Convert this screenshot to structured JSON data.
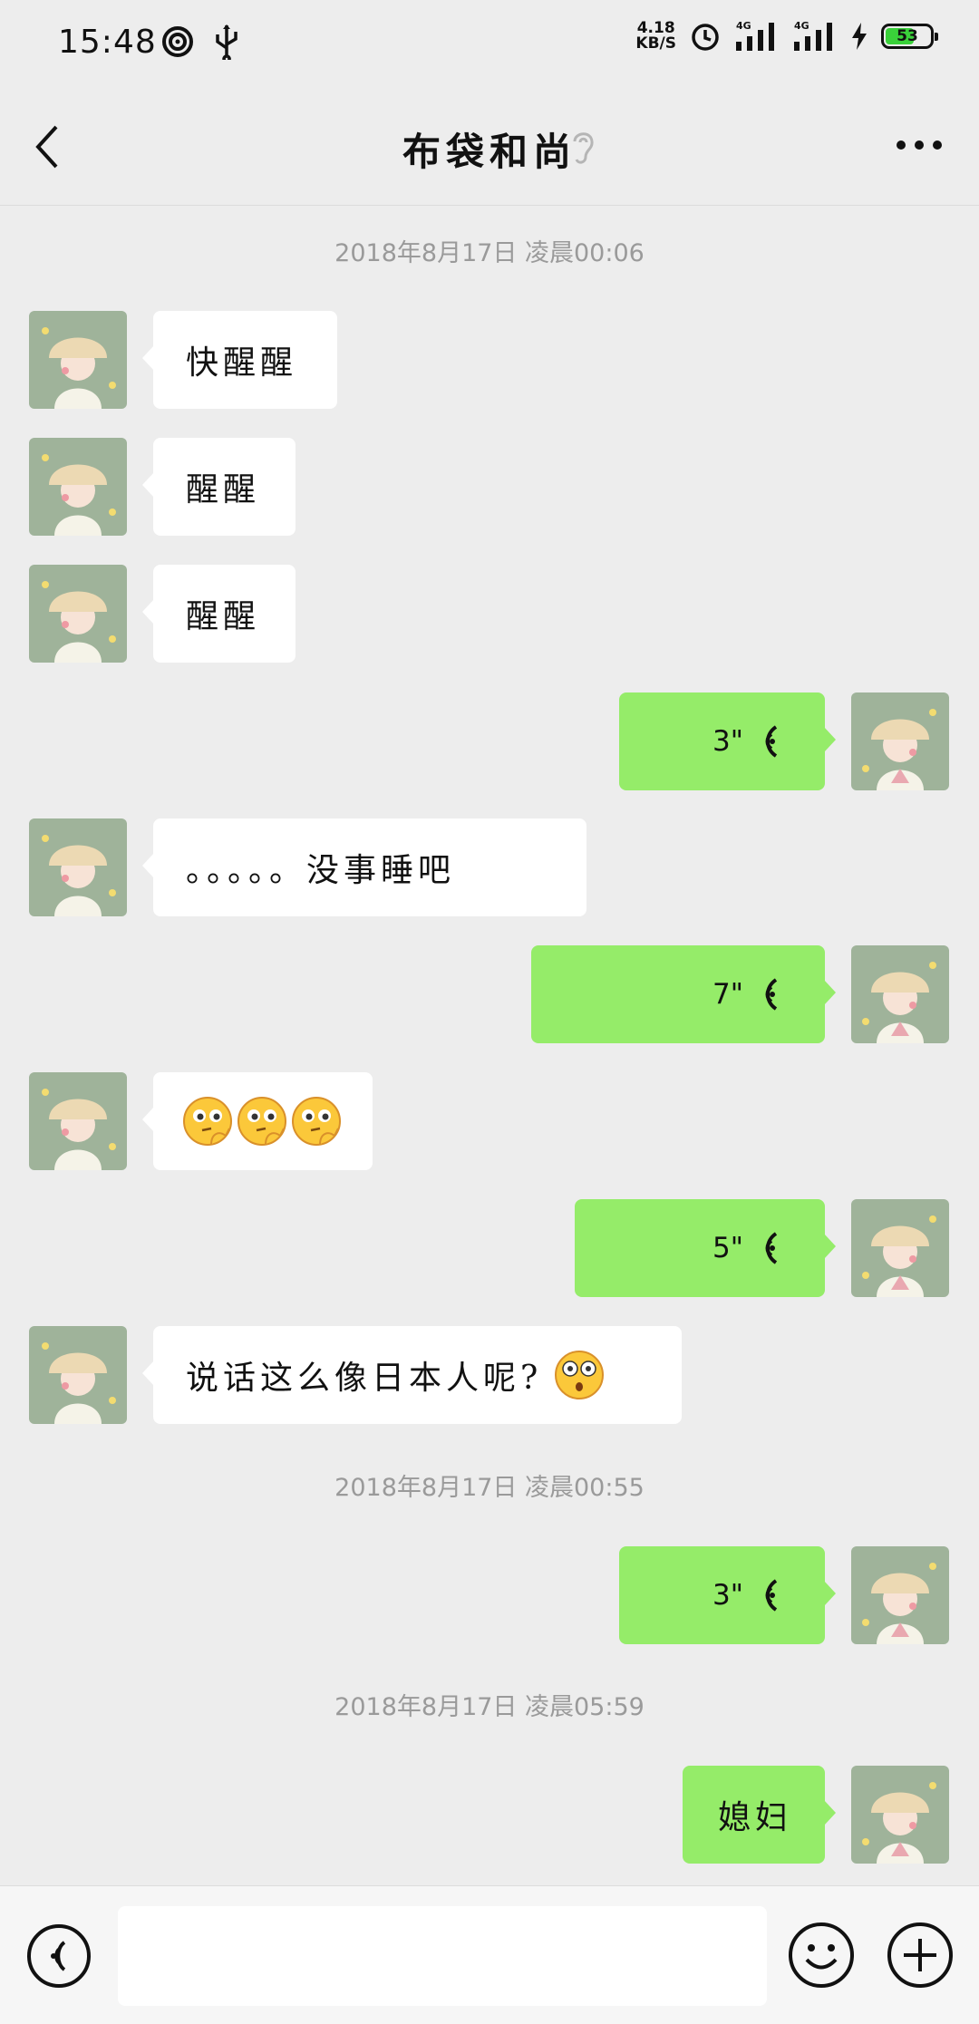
{
  "status_bar": {
    "time": "15:48",
    "net_speed_value": "4.18",
    "net_speed_unit": "KB/S",
    "battery_level": "53",
    "icons": [
      "hotspot-icon",
      "usb-icon",
      "alarm-icon",
      "signal-4g-icon",
      "signal-4g-icon",
      "charging-icon",
      "battery-icon"
    ]
  },
  "header": {
    "title": "布袋和尚",
    "icons": [
      "back-icon",
      "ear-icon",
      "more-icon"
    ]
  },
  "messages": [
    {
      "kind": "timestamp",
      "text": "2018年8月17日 凌晨00:06"
    },
    {
      "kind": "text",
      "side": "in",
      "text": "快醒醒"
    },
    {
      "kind": "text",
      "side": "in",
      "text": "醒醒"
    },
    {
      "kind": "text",
      "side": "in",
      "text": "醒醒"
    },
    {
      "kind": "voice",
      "side": "out",
      "duration": "3\""
    },
    {
      "kind": "text",
      "side": "in",
      "text": "。。。。。没事睡吧"
    },
    {
      "kind": "voice",
      "side": "out",
      "duration": "7\""
    },
    {
      "kind": "emoji",
      "side": "in",
      "emoji": [
        "thinking-face",
        "thinking-face",
        "thinking-face"
      ]
    },
    {
      "kind": "voice",
      "side": "out",
      "duration": "5\""
    },
    {
      "kind": "text",
      "side": "in",
      "text": "说话这么像日本人呢?",
      "emoji": "flushed-face"
    },
    {
      "kind": "timestamp",
      "text": "2018年8月17日 凌晨00:55"
    },
    {
      "kind": "voice",
      "side": "out",
      "duration": "3\""
    },
    {
      "kind": "timestamp",
      "text": "2018年8月17日 凌晨05:59"
    },
    {
      "kind": "text",
      "side": "out",
      "text": "媳妇"
    }
  ],
  "input_bar": {
    "placeholder": "",
    "icons": [
      "voice-toggle-icon",
      "emoji-icon",
      "plus-icon"
    ]
  },
  "colors": {
    "background": "#ededed",
    "incoming_bubble": "#ffffff",
    "outgoing_bubble": "#95ec69",
    "timestamp_text": "#9a9a9a",
    "battery_fill": "#3ad13a"
  }
}
